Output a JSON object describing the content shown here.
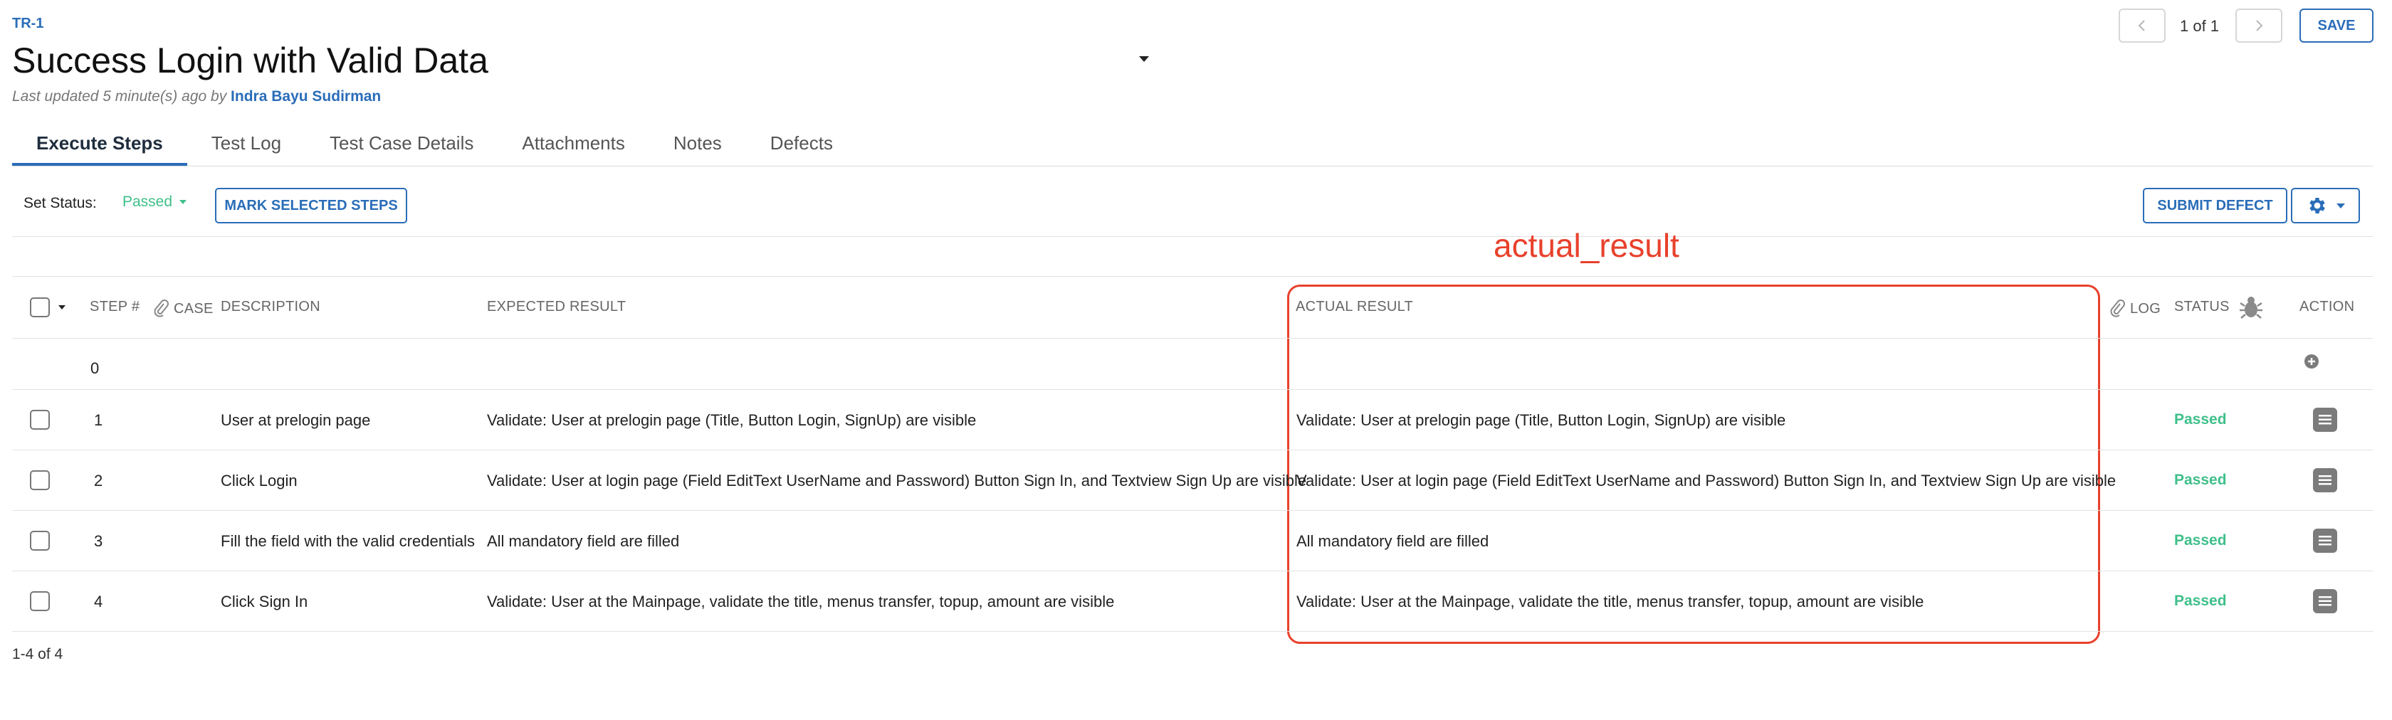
{
  "header": {
    "id": "TR-1",
    "title": "Success Login with Valid Data",
    "meta_prefix": "Last updated 5 minute(s) ago by",
    "author": "Indra Bayu Sudirman",
    "pager": "1 of 1",
    "save_label": "SAVE"
  },
  "tabs": [
    {
      "label": "Execute Steps",
      "active": true
    },
    {
      "label": "Test Log"
    },
    {
      "label": "Test Case Details"
    },
    {
      "label": "Attachments"
    },
    {
      "label": "Notes"
    },
    {
      "label": "Defects"
    }
  ],
  "toolbar": {
    "set_status_label": "Set Status:",
    "status_value": "Passed",
    "mark_label": "MARK SELECTED STEPS",
    "submit_defect_label": "SUBMIT DEFECT"
  },
  "annotation": {
    "label": "actual_result",
    "color": "#e8412c"
  },
  "table": {
    "headers": {
      "step": "STEP #",
      "case": "CASE",
      "description": "DESCRIPTION",
      "expected": "EXPECTED RESULT",
      "actual": "ACTUAL RESULT",
      "log": "LOG",
      "status": "STATUS",
      "action": "ACTION"
    },
    "zero_row": {
      "step": "0"
    },
    "rows": [
      {
        "step": "1",
        "description": "User at prelogin page",
        "expected": "Validate: User at prelogin page (Title, Button Login, SignUp) are visible",
        "actual": "Validate: User at prelogin page (Title, Button Login, SignUp) are visible",
        "status": "Passed"
      },
      {
        "step": "2",
        "description": "Click Login",
        "expected": "Validate: User at login page (Field EditText UserName and Password) Button Sign In, and Textview Sign Up are visible",
        "actual": "Validate: User at login page (Field EditText UserName and Password) Button Sign In, and Textview Sign Up are visible",
        "status": "Passed"
      },
      {
        "step": "3",
        "description": "Fill the field with the valid credentials",
        "expected": "All mandatory field are filled",
        "actual": "All mandatory field are filled",
        "status": "Passed"
      },
      {
        "step": "4",
        "description": "Click Sign In",
        "expected": "Validate: User at the Mainpage, validate the title, menus transfer, topup, amount are visible",
        "actual": "Validate: User at the Mainpage, validate the title, menus transfer, topup, amount are visible",
        "status": "Passed"
      }
    ],
    "count_label": "1-4 of 4"
  },
  "colors": {
    "accent": "#2a6db8",
    "passed": "#3fbf8a"
  }
}
